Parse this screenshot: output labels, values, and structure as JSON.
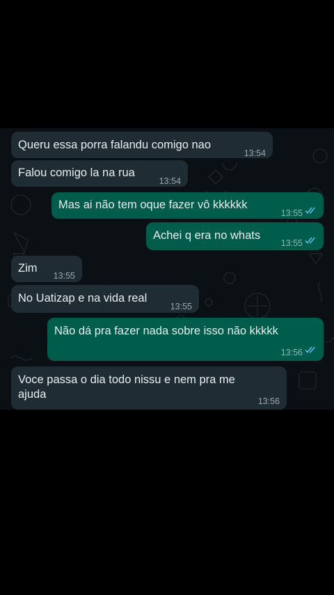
{
  "chat": {
    "messages": [
      {
        "direction": "in",
        "text": "Queru essa porra falandu comigo nao",
        "time": "13:54"
      },
      {
        "direction": "in",
        "text": "Falou comigo la na rua",
        "time": "13:54"
      },
      {
        "direction": "out",
        "text": "Mas ai não tem oque fazer vô kkkkkk",
        "time": "13:55",
        "status": "read"
      },
      {
        "direction": "out",
        "text": "Achei q era no whats",
        "time": "13:55",
        "status": "read"
      },
      {
        "direction": "in",
        "text": "Zim",
        "time": "13:55"
      },
      {
        "direction": "in",
        "text": "No Uatizap e na vida real",
        "time": "13:55"
      },
      {
        "direction": "out",
        "text": "Não dá pra fazer nada sobre isso não kkkkk",
        "time": "13:56",
        "status": "read"
      },
      {
        "direction": "in",
        "text": "Voce passa o dia todo nissu e nem pra me ajuda",
        "time": "13:56"
      }
    ]
  },
  "colors": {
    "background": "#0b1014",
    "incoming_bubble": "#1f2c34",
    "outgoing_bubble": "#005c4b",
    "read_ticks": "#53bdeb",
    "text": "#e9edef"
  }
}
